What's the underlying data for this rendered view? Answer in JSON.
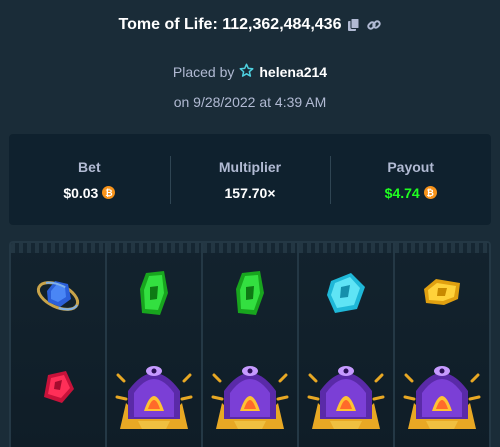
{
  "header": {
    "game_name": "Tome of Life",
    "bet_id": "112,362,484,436",
    "title_separator": ": "
  },
  "placed": {
    "prefix": "Placed by",
    "username": "helena214",
    "date_text": "on 9/28/2022 at 4:39 AM"
  },
  "stats": {
    "bet": {
      "label": "Bet",
      "value": "$0.03"
    },
    "multiplier": {
      "label": "Multiplier",
      "value": "157.70×"
    },
    "payout": {
      "label": "Payout",
      "value": "$4.74"
    }
  },
  "currency_icon": "bitcoin-icon",
  "colors": {
    "background": "#1a2c38",
    "panel": "#0f212e",
    "label": "#b1bad3",
    "payout_green": "#1fff20",
    "coin": "#f7931a"
  },
  "reels": [
    {
      "top": "blue-ring-gem",
      "bottom": "red-gem"
    },
    {
      "top": "green-gem",
      "bottom": "tome-of-life-emblem"
    },
    {
      "top": "green-gem",
      "bottom": "tome-of-life-emblem"
    },
    {
      "top": "cyan-gem",
      "bottom": "tome-of-life-emblem"
    },
    {
      "top": "gold-gem",
      "bottom": "tome-of-life-emblem"
    }
  ]
}
